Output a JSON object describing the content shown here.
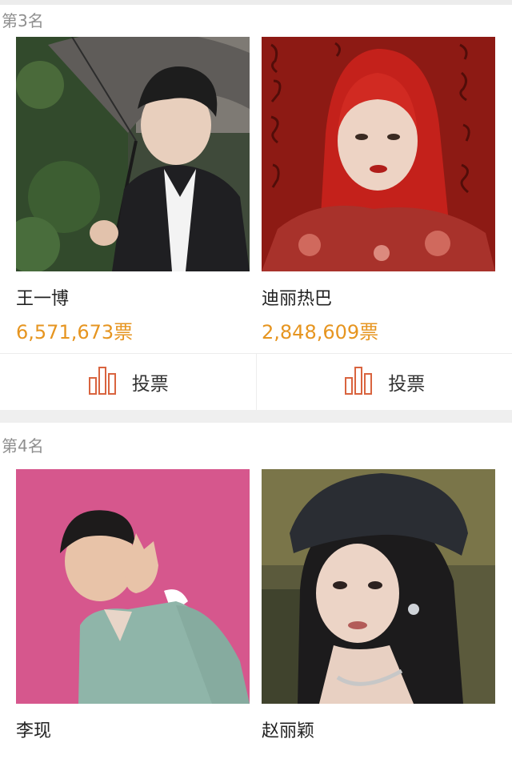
{
  "rank3": {
    "label": "第3名",
    "cards": [
      {
        "name": "王一博",
        "votes": "6,571,673票",
        "vote_label": "投票"
      },
      {
        "name": "迪丽热巴",
        "votes": "2,848,609票",
        "vote_label": "投票"
      }
    ]
  },
  "rank4": {
    "label": "第4名",
    "cards": [
      {
        "name": "李现"
      },
      {
        "name": "赵丽颖"
      }
    ]
  },
  "colors": {
    "vote_count": "#e69520",
    "vote_icon": "#d9643f",
    "rank_label": "#8f8f8f"
  },
  "icons": {
    "vote": "bar-chart-icon"
  }
}
